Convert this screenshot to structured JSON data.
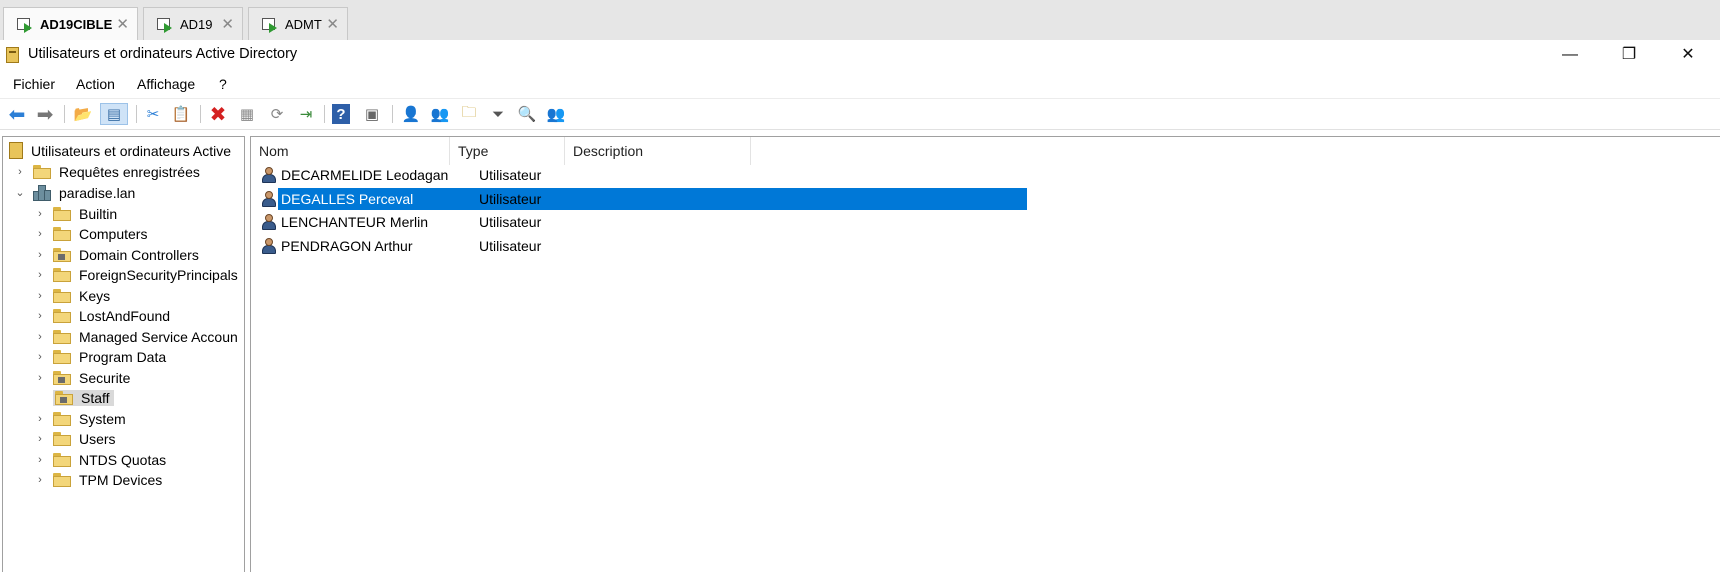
{
  "tabs": [
    {
      "label": "AD19CIBLE",
      "active": true
    },
    {
      "label": "AD19",
      "active": false
    },
    {
      "label": "ADMT",
      "active": false
    }
  ],
  "window": {
    "title": "Utilisateurs et ordinateurs Active Directory",
    "minimize": "—",
    "maximize": "❐",
    "close": "✕"
  },
  "menu": [
    "Fichier",
    "Action",
    "Affichage",
    "?"
  ],
  "tree": {
    "root": "Utilisateurs et ordinateurs Active",
    "saved_queries": "Requêtes enregistrées",
    "domain": "paradise.lan",
    "children": [
      {
        "label": "Builtin",
        "ou": false
      },
      {
        "label": "Computers",
        "ou": false
      },
      {
        "label": "Domain Controllers",
        "ou": true
      },
      {
        "label": "ForeignSecurityPrincipals",
        "ou": false
      },
      {
        "label": "Keys",
        "ou": false
      },
      {
        "label": "LostAndFound",
        "ou": false
      },
      {
        "label": "Managed Service Accoun",
        "ou": false
      },
      {
        "label": "Program Data",
        "ou": false
      },
      {
        "label": "Securite",
        "ou": true
      },
      {
        "label": "Staff",
        "ou": true,
        "selected": true
      },
      {
        "label": "System",
        "ou": false
      },
      {
        "label": "Users",
        "ou": false
      },
      {
        "label": "NTDS Quotas",
        "ou": false
      },
      {
        "label": "TPM Devices",
        "ou": false
      }
    ]
  },
  "list": {
    "columns": [
      "Nom",
      "Type",
      "Description"
    ],
    "rows": [
      {
        "name": "DECARMELIDE Leodagan",
        "type": "Utilisateur",
        "description": ""
      },
      {
        "name": "DEGALLES Perceval",
        "type": "Utilisateur",
        "description": "",
        "selected": true
      },
      {
        "name": "LENCHANTEUR Merlin",
        "type": "Utilisateur",
        "description": ""
      },
      {
        "name": "PENDRAGON Arthur",
        "type": "Utilisateur",
        "description": ""
      }
    ]
  },
  "colors": {
    "selection": "#0078d7",
    "tree_selection": "#d9d9d9"
  }
}
